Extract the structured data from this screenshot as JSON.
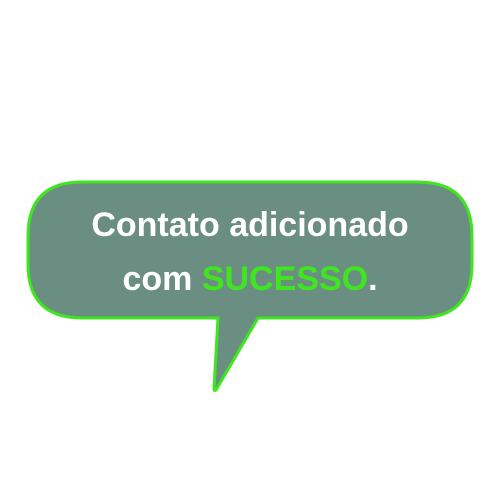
{
  "toast": {
    "line1": "Contato adicionado",
    "line2_prefix": "com ",
    "highlight": "SUCESSO",
    "line2_suffix": ".",
    "fill_color": "#6a8f82",
    "border_color": "#3fe61f",
    "highlight_color": "#3fe61f",
    "text_color": "#ffffff"
  }
}
